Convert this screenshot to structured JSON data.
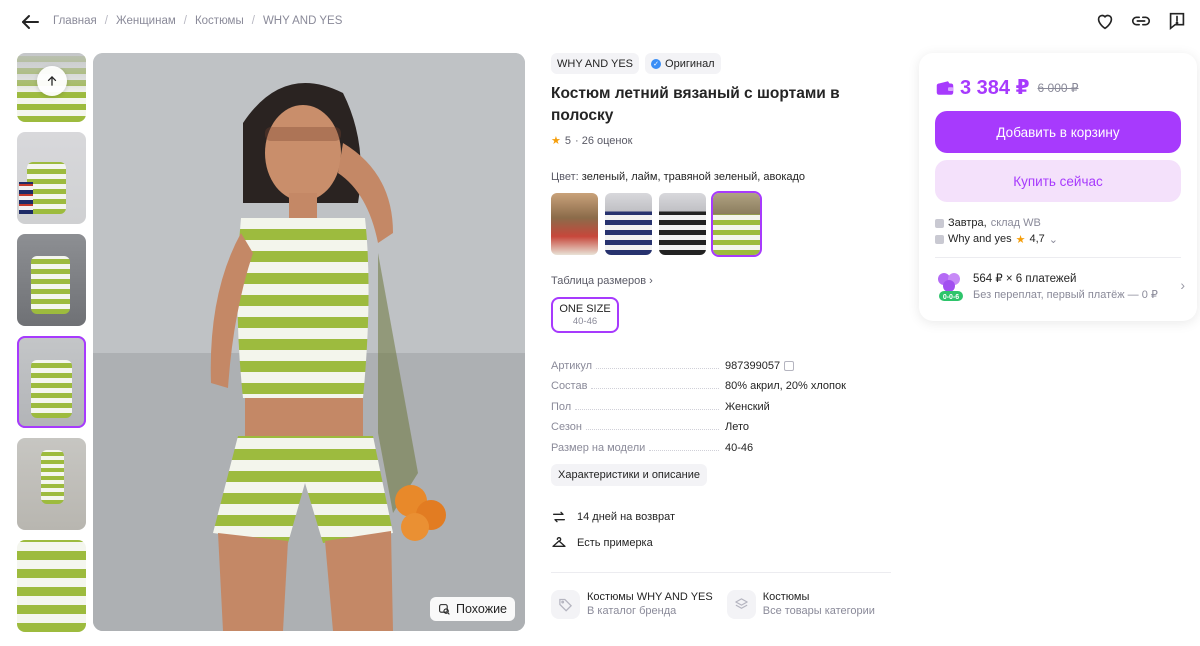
{
  "breadcrumb": [
    "Главная",
    "Женщинам",
    "Костюмы",
    "WHY AND YES"
  ],
  "product": {
    "brand": "WHY AND YES",
    "original_label": "Оригинал",
    "title": "Костюм летний вязаный с шортами в полоску",
    "rating": "5",
    "reviews": "· 26 оценок",
    "color_label": "Цвет:",
    "color_value": "зеленый, лайм, травяной зеленый, авокадо",
    "size_table": "Таблица размеров ›",
    "size": {
      "name": "ONE SIZE",
      "range": "40-46"
    },
    "specs": [
      {
        "key": "Артикул",
        "value": "987399057"
      },
      {
        "key": "Состав",
        "value": "80% акрил, 20% хлопок"
      },
      {
        "key": "Пол",
        "value": "Женский"
      },
      {
        "key": "Сезон",
        "value": "Лето"
      },
      {
        "key": "Размер на модели",
        "value": "40-46"
      }
    ],
    "char_button": "Характеристики и описание",
    "features": [
      "14 дней на возврат",
      "Есть примерка"
    ],
    "categories": [
      {
        "title": "Костюмы WHY AND YES",
        "sub": "В каталог бренда"
      },
      {
        "title": "Костюмы",
        "sub": "Все товары категории"
      }
    ],
    "similar": "Похожие"
  },
  "buy": {
    "price": "3 384 ₽",
    "old_price": "6 000 ₽",
    "add_to_cart": "Добавить в корзину",
    "buy_now": "Купить сейчас",
    "delivery_day": "Завтра,",
    "delivery_wh": "склад WB",
    "seller": "Why and yes",
    "seller_rating": "4,7",
    "installment_title": "564 ₽ × 6 платежей",
    "installment_sub": "Без переплат, первый платёж — 0 ₽"
  },
  "colors": {
    "accent": "#a73afd",
    "accent_light": "#f4e1fb",
    "green": "#9dbb3e",
    "star": "#f59e0b"
  }
}
